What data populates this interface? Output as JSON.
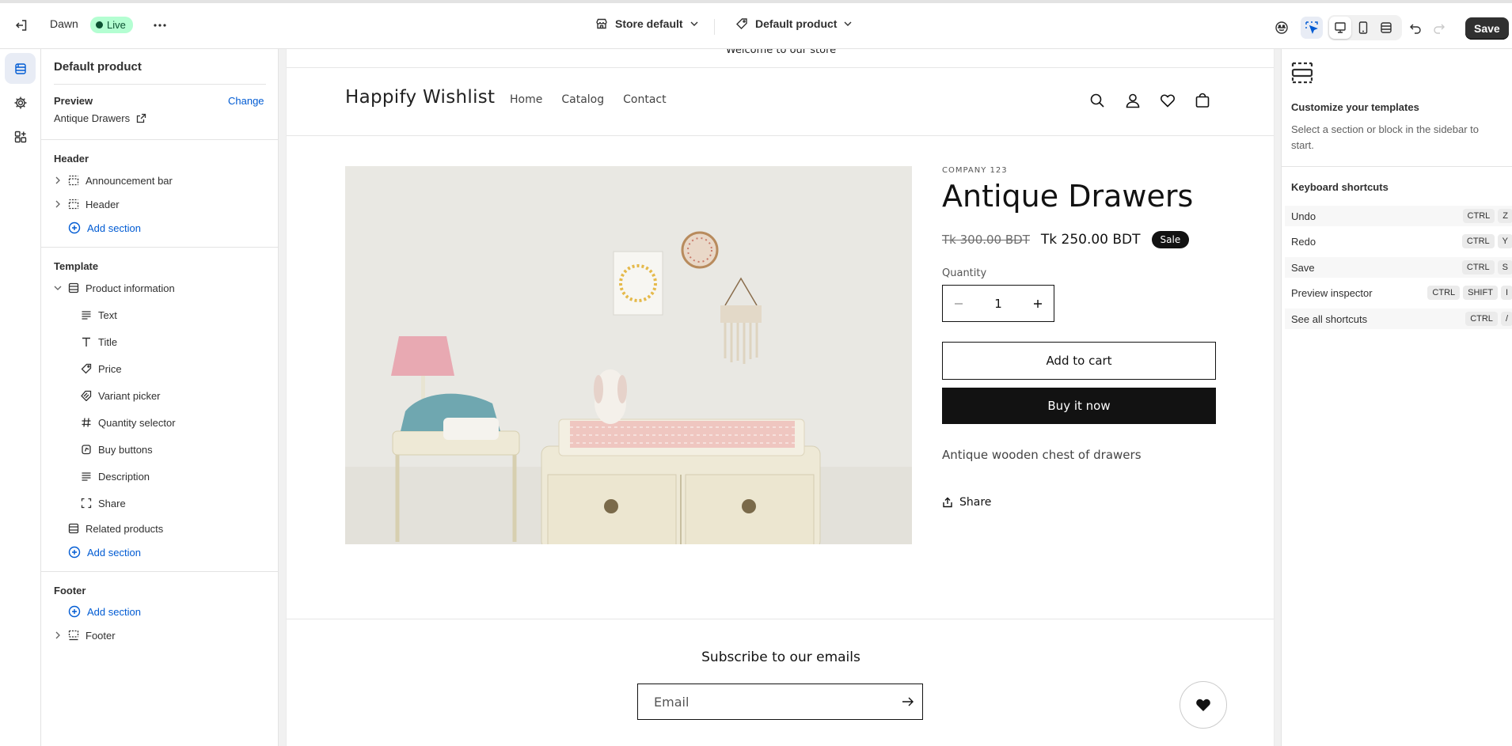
{
  "topbar": {
    "theme_name": "Dawn",
    "live_badge": "Live",
    "store_context": "Store default",
    "template_context": "Default product",
    "save_label": "Save"
  },
  "sidebar": {
    "title": "Default product",
    "preview_label": "Preview",
    "preview_change": "Change",
    "preview_product": "Antique Drawers",
    "header_group": "Header",
    "header_items": [
      {
        "label": "Announcement bar",
        "icon": "section-icon"
      },
      {
        "label": "Header",
        "icon": "section-icon"
      }
    ],
    "add_section": "Add section",
    "template_group": "Template",
    "product_information": "Product information",
    "blocks": [
      {
        "label": "Text",
        "icon": "text-lines-icon"
      },
      {
        "label": "Title",
        "icon": "title-t-icon"
      },
      {
        "label": "Price",
        "icon": "price-tag-icon"
      },
      {
        "label": "Variant picker",
        "icon": "variant-icon"
      },
      {
        "label": "Quantity selector",
        "icon": "hash-icon"
      },
      {
        "label": "Buy buttons",
        "icon": "buy-buttons-icon"
      },
      {
        "label": "Description",
        "icon": "text-lines-icon"
      },
      {
        "label": "Share",
        "icon": "share-frame-icon"
      }
    ],
    "related_products": "Related products",
    "footer_group": "Footer",
    "footer_item": "Footer"
  },
  "store": {
    "announcement": "Welcome to our store",
    "logo": "Happify Wishlist",
    "nav": [
      "Home",
      "Catalog",
      "Contact"
    ],
    "vendor": "COMPANY 123",
    "product_title": "Antique Drawers",
    "compare_price": "Tk 300.00 BDT",
    "price": "Tk 250.00 BDT",
    "sale_badge": "Sale",
    "quantity_label": "Quantity",
    "quantity_value": "1",
    "add_to_cart": "Add to cart",
    "buy_now": "Buy it now",
    "description": "Antique wooden chest of drawers",
    "share": "Share",
    "newsletter_title": "Subscribe to our emails",
    "email_placeholder": "Email"
  },
  "right_panel": {
    "title": "Customize your templates",
    "subtitle": "Select a section or block in the sidebar to start.",
    "shortcuts_title": "Keyboard shortcuts",
    "shortcuts": [
      {
        "label": "Undo",
        "keys": [
          "CTRL",
          "Z"
        ]
      },
      {
        "label": "Redo",
        "keys": [
          "CTRL",
          "Y"
        ]
      },
      {
        "label": "Save",
        "keys": [
          "CTRL",
          "S"
        ]
      },
      {
        "label": "Preview inspector",
        "keys": [
          "CTRL",
          "SHIFT",
          "I"
        ]
      },
      {
        "label": "See all shortcuts",
        "keys": [
          "CTRL",
          "/"
        ]
      }
    ]
  },
  "colors": {
    "accent_blue": "#005bd3",
    "live_green": "#b4fed2",
    "dark_button": "#121212",
    "save_button": "#303030"
  }
}
